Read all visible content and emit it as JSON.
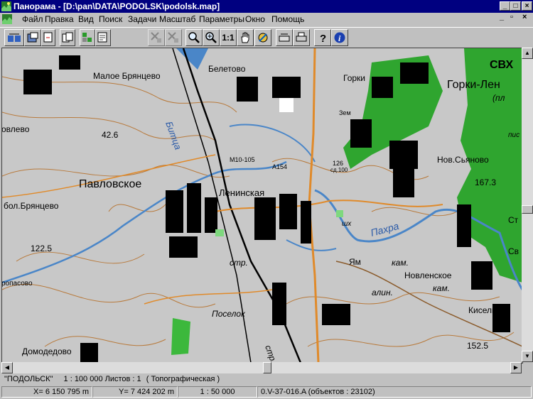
{
  "window": {
    "title": "Панорама - [D:\\pan\\DATA\\PODOLSK\\podolsk.map]",
    "controls": [
      "_",
      "□",
      "×"
    ]
  },
  "menu": [
    "Файл",
    "Правка",
    "Вид",
    "Поиск",
    "Задачи",
    "Масштаб",
    "Параметры",
    "Окно",
    "Помощь"
  ],
  "toolbar": {
    "icons": [
      "open-map-icon",
      "save-map-icon",
      "new-document-icon",
      "copy-layer-icon",
      "layers-icon",
      "print-preview-icon",
      "select-object-icon",
      "select-disabled-icon",
      "zoom-out-icon",
      "zoom-in-icon",
      "pan-hand-icon",
      "map-options-icon",
      "scanner-icon",
      "printer-icon",
      "help-icon",
      "info-icon"
    ],
    "scale_one_label": "1:1"
  },
  "map": {
    "labels": {
      "malo_bryantsevo": "Малое Брянцево",
      "beletovo": "Белетово",
      "gorki": "Горки",
      "svh": "СВХ",
      "gorki_len": "Горки-Лен",
      "pl": "(пл",
      "bitsa": "Битца",
      "ovlevo": "овлево",
      "elev_426": "42.6",
      "m10": "М10-105",
      "a154": "А154",
      "pavlovskoe": "Павловское",
      "leninskaya": "Ленинская",
      "sd100": "сд.100",
      "elev_126": "126",
      "nov_syanovo": "Нов.Сьяново",
      "elev_1673": "167.3",
      "bol_bryantsevo": "бол.Брянцево",
      "pakhra": "Пахра",
      "elev_1225": "122.5",
      "str1": "стр.",
      "yam": "Ям",
      "kam1": "кам.",
      "novlenskoe": "Новленское",
      "kam2": "кам.",
      "alin": "алин.",
      "poselok": "Поселок",
      "kiselikha": "Киселиха",
      "str2": "стр.",
      "elev_1525": "152.5",
      "domodedovo": "Домодедово",
      "ropasovo": "ропасово",
      "zem": "Зем",
      "pis": "пис",
      "st": "Ст",
      "shkh": "шх",
      "sv": "Св"
    }
  },
  "status": {
    "map_name": "\"ПОДОЛЬСК\"",
    "scale_and_sheets": "1 : 100 000  Листов : 1",
    "map_type": "( Топографическая )",
    "x_coord": "X= 6 150 795 m",
    "y_coord": "Y= 7 424 202 m",
    "current_scale": "1 : 50 000",
    "sheet_info": "0.V-37-016.A  (объектов : 23102)"
  },
  "colors": {
    "title_bg": "#000080",
    "map_bg": "#c8c8c8",
    "forest": "#2fa52f",
    "water": "#4a86c8",
    "contour": "#b87a3c",
    "buildings": "#000000"
  }
}
